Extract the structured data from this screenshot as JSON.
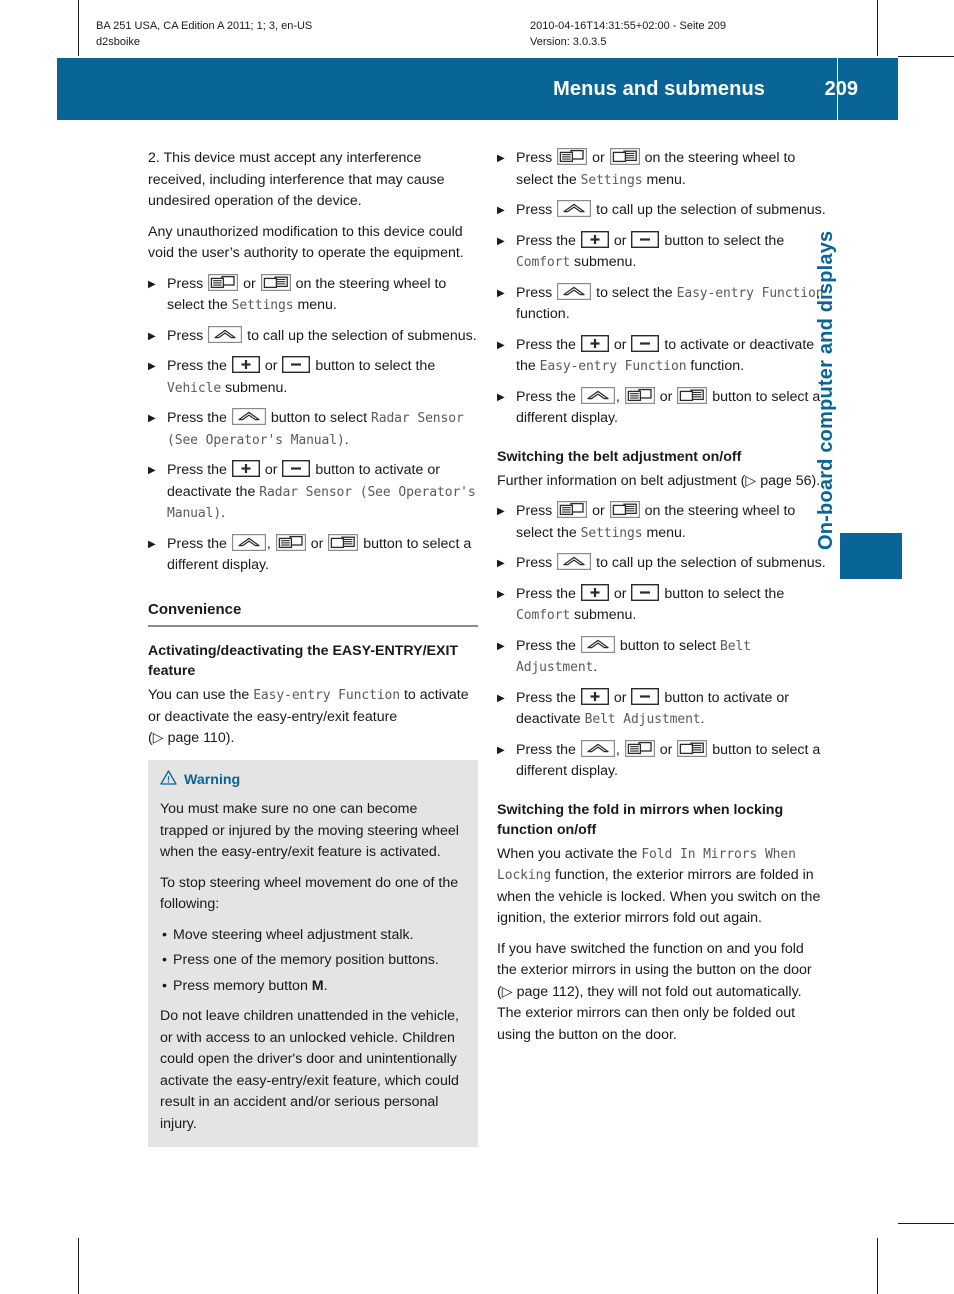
{
  "meta": {
    "left_line1": "BA 251 USA, CA Edition A 2011; 1; 3, en-US",
    "left_line2": "d2sboike",
    "right_line1": "2010-04-16T14:31:55+02:00 - Seite 209",
    "right_line2": "Version: 3.0.3.5"
  },
  "header": {
    "title": "Menus and submenus",
    "page_number": "209",
    "accent_color": "#0a6597"
  },
  "thumb_tab": {
    "label": "On-board computer and displays"
  },
  "left_column": {
    "intro_para_1": "2. This device must accept any interference received, including interference that may cause undesired operation of the device.",
    "intro_para_2": "Any unauthorized modification to this device could void the user’s authority to operate the equipment.",
    "steps": [
      {
        "parts": [
          {
            "t": "text",
            "v": "Press "
          },
          {
            "t": "icon",
            "v": "display-left-icon"
          },
          {
            "t": "text",
            "v": " or "
          },
          {
            "t": "icon",
            "v": "display-right-icon"
          },
          {
            "t": "text",
            "v": " on the steering wheel to select the "
          },
          {
            "t": "mono",
            "v": "Settings"
          },
          {
            "t": "text",
            "v": " menu."
          }
        ]
      },
      {
        "parts": [
          {
            "t": "text",
            "v": "Press "
          },
          {
            "t": "icon",
            "v": "up-arrow-icon"
          },
          {
            "t": "text",
            "v": " to call up the selection of submenus."
          }
        ]
      },
      {
        "parts": [
          {
            "t": "text",
            "v": "Press the "
          },
          {
            "t": "icon",
            "v": "plus-icon"
          },
          {
            "t": "text",
            "v": " or "
          },
          {
            "t": "icon",
            "v": "minus-icon"
          },
          {
            "t": "text",
            "v": " button to select the "
          },
          {
            "t": "mono",
            "v": "Vehicle"
          },
          {
            "t": "text",
            "v": " submenu."
          }
        ]
      },
      {
        "parts": [
          {
            "t": "text",
            "v": "Press the "
          },
          {
            "t": "icon",
            "v": "up-arrow-icon"
          },
          {
            "t": "text",
            "v": " button to select "
          },
          {
            "t": "mono",
            "v": "Radar Sensor (See Operator's Manual)"
          },
          {
            "t": "text",
            "v": "."
          }
        ]
      },
      {
        "parts": [
          {
            "t": "text",
            "v": "Press the "
          },
          {
            "t": "icon",
            "v": "plus-icon"
          },
          {
            "t": "text",
            "v": " or "
          },
          {
            "t": "icon",
            "v": "minus-icon"
          },
          {
            "t": "text",
            "v": " button to activate or deactivate the "
          },
          {
            "t": "mono",
            "v": "Radar Sensor (See Operator's Manual)"
          },
          {
            "t": "text",
            "v": "."
          }
        ]
      },
      {
        "parts": [
          {
            "t": "text",
            "v": "Press the "
          },
          {
            "t": "icon",
            "v": "up-arrow-icon"
          },
          {
            "t": "text",
            "v": ", "
          },
          {
            "t": "icon",
            "v": "display-left-icon"
          },
          {
            "t": "text",
            "v": " or "
          },
          {
            "t": "icon",
            "v": "display-right-icon"
          },
          {
            "t": "text",
            "v": " button to select a different display."
          }
        ]
      }
    ],
    "section_heading": "Convenience",
    "sub_heading": "Activating/deactivating the EASY-ENTRY/EXIT feature",
    "body_parts": [
      {
        "t": "text",
        "v": "You can use the "
      },
      {
        "t": "mono",
        "v": "Easy-entry Function"
      },
      {
        "t": "text",
        "v": " to activate or deactivate the easy-entry/exit feature ("
      },
      {
        "t": "ref",
        "v": "▷ page 110"
      },
      {
        "t": "text",
        "v": ")."
      }
    ],
    "warning": {
      "title": "Warning",
      "icon": "warning-triangle-icon",
      "para_1": "You must make sure no one can become trapped or injured by the moving steering wheel when the easy-entry/exit feature is activated.",
      "para_2": "To stop steering wheel movement do one of the following:",
      "bullets": [
        "Move steering wheel adjustment stalk.",
        "Press one of the memory position buttons.",
        "Press memory button M."
      ],
      "bullet_bold_last": "M",
      "para_3": "Do not leave children unattended in the vehicle, or with access to an unlocked vehicle. Children could open the driver's door and unintentionally activate the easy-entry/exit feature, which could result in an accident and/or serious personal injury."
    }
  },
  "right_column": {
    "steps_group_1": [
      {
        "parts": [
          {
            "t": "text",
            "v": "Press "
          },
          {
            "t": "icon",
            "v": "display-left-icon"
          },
          {
            "t": "text",
            "v": " or "
          },
          {
            "t": "icon",
            "v": "display-right-icon"
          },
          {
            "t": "text",
            "v": " on the steering wheel to select the "
          },
          {
            "t": "mono",
            "v": "Settings"
          },
          {
            "t": "text",
            "v": " menu."
          }
        ]
      },
      {
        "parts": [
          {
            "t": "text",
            "v": "Press "
          },
          {
            "t": "icon",
            "v": "up-arrow-icon"
          },
          {
            "t": "text",
            "v": " to call up the selection of submenus."
          }
        ]
      },
      {
        "parts": [
          {
            "t": "text",
            "v": "Press the "
          },
          {
            "t": "icon",
            "v": "plus-icon"
          },
          {
            "t": "text",
            "v": " or "
          },
          {
            "t": "icon",
            "v": "minus-icon"
          },
          {
            "t": "text",
            "v": " button to select the "
          },
          {
            "t": "mono",
            "v": "Comfort"
          },
          {
            "t": "text",
            "v": " submenu."
          }
        ]
      },
      {
        "parts": [
          {
            "t": "text",
            "v": "Press "
          },
          {
            "t": "icon",
            "v": "up-arrow-icon"
          },
          {
            "t": "text",
            "v": " to select the "
          },
          {
            "t": "mono",
            "v": "Easy-entry Function"
          },
          {
            "t": "text",
            "v": " function."
          }
        ]
      },
      {
        "parts": [
          {
            "t": "text",
            "v": "Press the "
          },
          {
            "t": "icon",
            "v": "plus-icon"
          },
          {
            "t": "text",
            "v": " or "
          },
          {
            "t": "icon",
            "v": "minus-icon"
          },
          {
            "t": "text",
            "v": " to activate or deactivate the "
          },
          {
            "t": "mono",
            "v": "Easy-entry Function"
          },
          {
            "t": "text",
            "v": " function."
          }
        ]
      },
      {
        "parts": [
          {
            "t": "text",
            "v": "Press the "
          },
          {
            "t": "icon",
            "v": "up-arrow-icon"
          },
          {
            "t": "text",
            "v": ", "
          },
          {
            "t": "icon",
            "v": "display-left-icon"
          },
          {
            "t": "text",
            "v": " or "
          },
          {
            "t": "icon",
            "v": "display-right-icon"
          },
          {
            "t": "text",
            "v": " button to select a different display."
          }
        ]
      }
    ],
    "belt_heading": "Switching the belt adjustment on/off",
    "belt_intro_parts": [
      {
        "t": "text",
        "v": "Further information on belt adjustment ("
      },
      {
        "t": "ref",
        "v": "▷ page 56"
      },
      {
        "t": "text",
        "v": ")."
      }
    ],
    "steps_group_2": [
      {
        "parts": [
          {
            "t": "text",
            "v": "Press "
          },
          {
            "t": "icon",
            "v": "display-left-icon"
          },
          {
            "t": "text",
            "v": " or "
          },
          {
            "t": "icon",
            "v": "display-right-icon"
          },
          {
            "t": "text",
            "v": " on the steering wheel to select the "
          },
          {
            "t": "mono",
            "v": "Settings"
          },
          {
            "t": "text",
            "v": " menu."
          }
        ]
      },
      {
        "parts": [
          {
            "t": "text",
            "v": "Press "
          },
          {
            "t": "icon",
            "v": "up-arrow-icon"
          },
          {
            "t": "text",
            "v": " to call up the selection of submenus."
          }
        ]
      },
      {
        "parts": [
          {
            "t": "text",
            "v": "Press the "
          },
          {
            "t": "icon",
            "v": "plus-icon"
          },
          {
            "t": "text",
            "v": " or "
          },
          {
            "t": "icon",
            "v": "minus-icon"
          },
          {
            "t": "text",
            "v": " button to select the "
          },
          {
            "t": "mono",
            "v": "Comfort"
          },
          {
            "t": "text",
            "v": " submenu."
          }
        ]
      },
      {
        "parts": [
          {
            "t": "text",
            "v": "Press the "
          },
          {
            "t": "icon",
            "v": "up-arrow-icon"
          },
          {
            "t": "text",
            "v": " button to select "
          },
          {
            "t": "mono",
            "v": "Belt Adjustment"
          },
          {
            "t": "text",
            "v": "."
          }
        ]
      },
      {
        "parts": [
          {
            "t": "text",
            "v": "Press the "
          },
          {
            "t": "icon",
            "v": "plus-icon"
          },
          {
            "t": "text",
            "v": " or "
          },
          {
            "t": "icon",
            "v": "minus-icon"
          },
          {
            "t": "text",
            "v": " button to activate or deactivate "
          },
          {
            "t": "mono",
            "v": "Belt Adjustment"
          },
          {
            "t": "text",
            "v": "."
          }
        ]
      },
      {
        "parts": [
          {
            "t": "text",
            "v": "Press the "
          },
          {
            "t": "icon",
            "v": "up-arrow-icon"
          },
          {
            "t": "text",
            "v": ", "
          },
          {
            "t": "icon",
            "v": "display-left-icon"
          },
          {
            "t": "text",
            "v": " or "
          },
          {
            "t": "icon",
            "v": "display-right-icon"
          },
          {
            "t": "text",
            "v": " button to select a different display."
          }
        ]
      }
    ],
    "mirrors_heading": "Switching the fold in mirrors when locking function on/off",
    "mirrors_para_1_parts": [
      {
        "t": "text",
        "v": "When you activate the "
      },
      {
        "t": "mono",
        "v": "Fold In Mirrors When Locking"
      },
      {
        "t": "text",
        "v": " function, the exterior mirrors are folded in when the vehicle is locked. When you switch on the ignition, the exterior mirrors fold out again."
      }
    ],
    "mirrors_para_2_parts": [
      {
        "t": "text",
        "v": "If you have switched the function on and you fold the exterior mirrors in using the button on the door ("
      },
      {
        "t": "ref",
        "v": "▷ page 112"
      },
      {
        "t": "text",
        "v": "), they will not fold out automatically. The exterior mirrors can then only be folded out using the button on the door."
      }
    ]
  }
}
